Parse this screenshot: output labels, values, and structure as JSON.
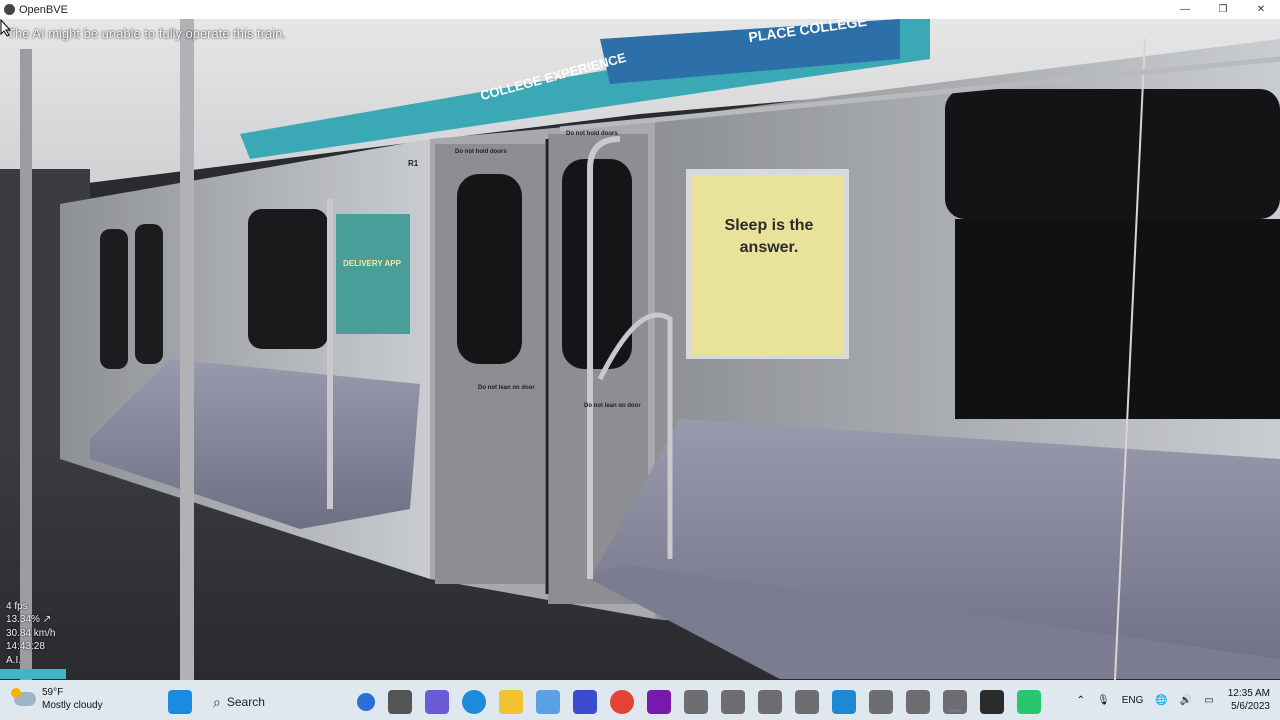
{
  "window": {
    "title": "OpenBVE",
    "minimize_glyph": "—",
    "restore_glyph": "❐",
    "close_glyph": "✕"
  },
  "hud": {
    "message": "The AI might be unable to fully operate this train.",
    "fps": "4 fps",
    "gradient": "13.34% ↗",
    "speed": "30.84 km/h",
    "time": "14:43:28",
    "mode": "A.I."
  },
  "scene_text": {
    "ad_college": "COLLEGE EXPERIENCE",
    "ad_college_top": "PLACE COLLEGE",
    "sleep_ad": "Sleep is the answer.",
    "door_sign_left": "Do not hold doors",
    "door_sign_right": "Do not hold doors",
    "lean_left": "Do not lean on door",
    "lean_right": "Do not lean on door",
    "delivery_ad": "DELIVERY APP",
    "car_number": "R1"
  },
  "taskbar": {
    "weather_temp": "59°F",
    "weather_desc": "Mostly cloudy",
    "search_placeholder": "Search",
    "language": "ENG",
    "clock_time": "12:35 AM",
    "clock_date": "5/6/2023"
  },
  "colors": {
    "titlebar": "#ffffff",
    "taskbar": "#dfe7ef",
    "seat": "#8a8a9e",
    "wall": "#b9bcc0",
    "sleep_ad_bg": "#e9e29a",
    "hud_strip": "#3fb7c2"
  }
}
